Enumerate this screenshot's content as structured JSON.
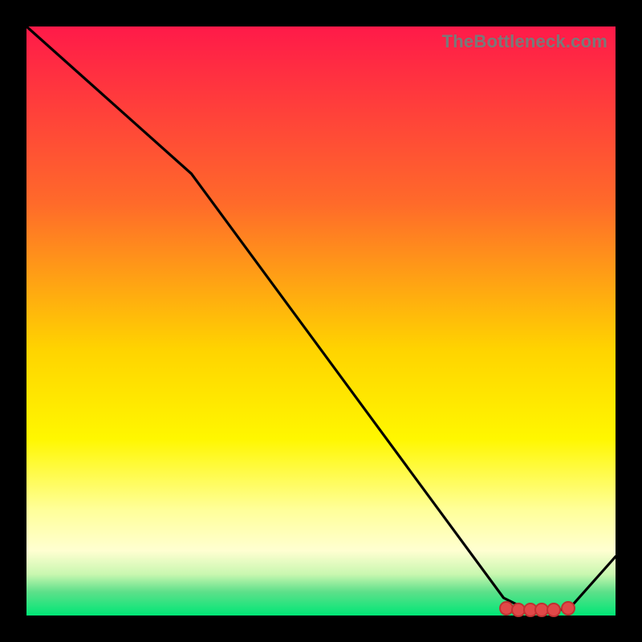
{
  "watermark": "TheBottleneck.com",
  "colors": {
    "frame_bg": "#000000",
    "curve_stroke": "#000000",
    "marker_fill": "#e04848",
    "marker_border": "#c03131",
    "gradient_stops": [
      {
        "offset": 0.0,
        "color": "#ff1a49"
      },
      {
        "offset": 0.3,
        "color": "#ff6a2a"
      },
      {
        "offset": 0.55,
        "color": "#ffd400"
      },
      {
        "offset": 0.7,
        "color": "#fff700"
      },
      {
        "offset": 0.82,
        "color": "#ffff99"
      },
      {
        "offset": 0.89,
        "color": "#ffffd1"
      },
      {
        "offset": 0.93,
        "color": "#c9f7b0"
      },
      {
        "offset": 0.96,
        "color": "#5de08a"
      },
      {
        "offset": 1.0,
        "color": "#00e676"
      }
    ]
  },
  "chart_data": {
    "type": "line",
    "title": "",
    "xlabel": "",
    "ylabel": "",
    "xlim": [
      0,
      100
    ],
    "ylim": [
      0,
      100
    ],
    "series": [
      {
        "name": "bottleneck-curve",
        "x": [
          0,
          28,
          81,
          85,
          92,
          100
        ],
        "values": [
          100,
          75,
          3,
          1,
          1,
          10
        ]
      }
    ],
    "markers": {
      "name": "optimal-range",
      "x": [
        81.5,
        83.5,
        85.5,
        87.5,
        89.5,
        92.0
      ],
      "values": [
        1.2,
        1.0,
        1.0,
        1.0,
        1.0,
        1.3
      ]
    }
  },
  "layout": {
    "frame_size": 800,
    "plot_inset": 33,
    "plot_size": 734
  }
}
